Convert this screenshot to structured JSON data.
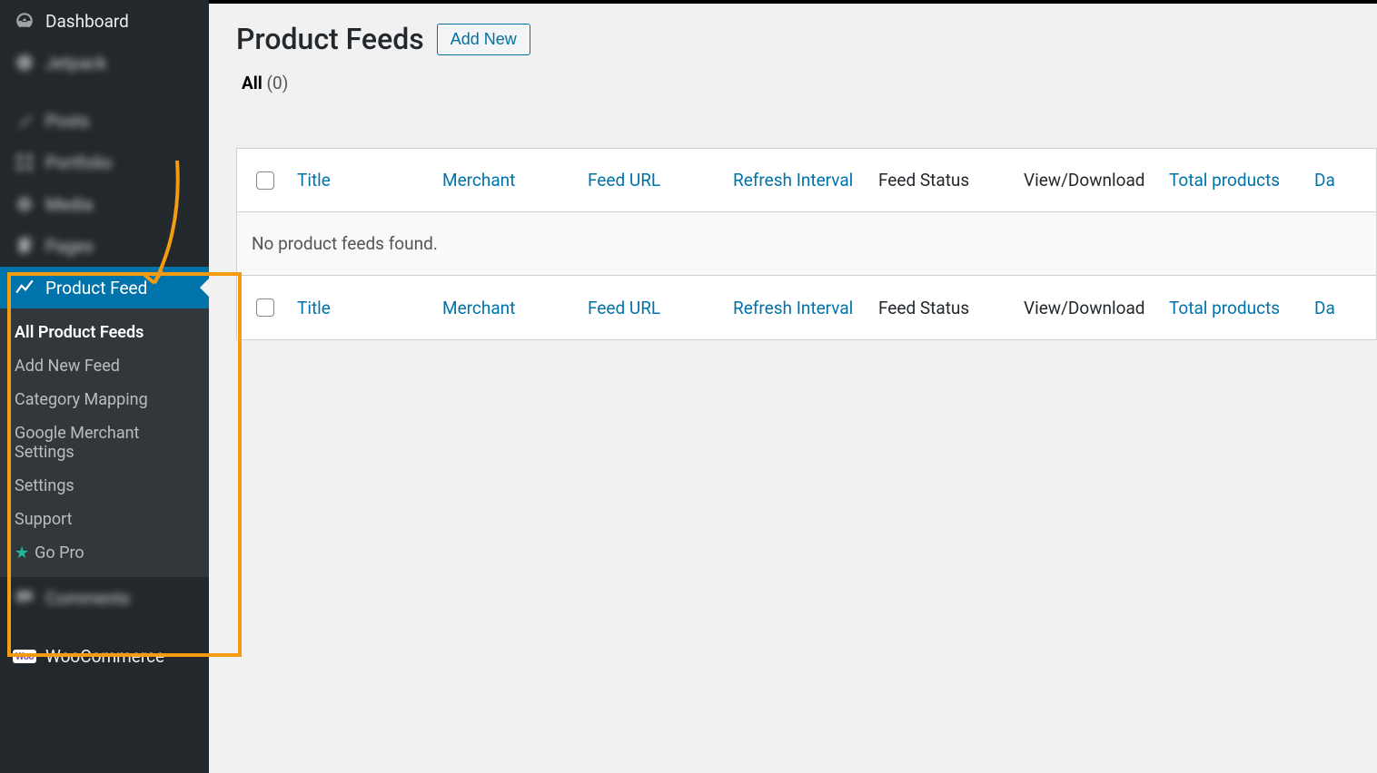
{
  "sidebar": {
    "items": [
      {
        "label": "Dashboard",
        "icon": "gauge",
        "active": false,
        "blurred": false
      },
      {
        "label": "Jetpack",
        "icon": "circle",
        "active": false,
        "blurred": true
      },
      {
        "label": "Posts",
        "icon": "pin",
        "active": false,
        "blurred": true
      },
      {
        "label": "Portfolio",
        "icon": "grid",
        "active": false,
        "blurred": true
      },
      {
        "label": "Media",
        "icon": "media",
        "active": false,
        "blurred": true
      },
      {
        "label": "Pages",
        "icon": "pages",
        "active": false,
        "blurred": true
      },
      {
        "label": "Product Feed",
        "icon": "chart",
        "active": true,
        "blurred": false
      },
      {
        "label": "Comments",
        "icon": "comment",
        "active": false,
        "blurred": true
      },
      {
        "label": "WooCommerce",
        "icon": "woo",
        "active": false,
        "blurred": false
      }
    ],
    "submenu": [
      {
        "label": "All Product Feeds",
        "current": true
      },
      {
        "label": "Add New Feed",
        "current": false
      },
      {
        "label": "Category Mapping",
        "current": false
      },
      {
        "label": "Google Merchant Settings",
        "current": false
      },
      {
        "label": "Settings",
        "current": false
      },
      {
        "label": "Support",
        "current": false
      },
      {
        "label": "Go Pro",
        "current": false,
        "star": true
      }
    ]
  },
  "header": {
    "title": "Product Feeds",
    "add_new": "Add New"
  },
  "filter": {
    "label": "All",
    "count_text": "(0)"
  },
  "table": {
    "columns": {
      "title": "Title",
      "merchant": "Merchant",
      "feed_url": "Feed URL",
      "refresh_interval": "Refresh Interval",
      "feed_status": "Feed Status",
      "view_download": "View/Download",
      "total_products": "Total products",
      "date": "Da"
    },
    "empty_message": "No product feeds found."
  }
}
